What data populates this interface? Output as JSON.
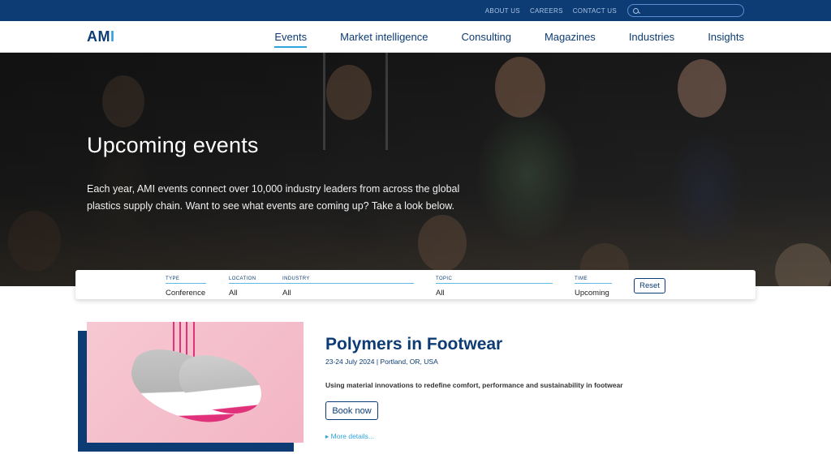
{
  "topbar": {
    "links": [
      "ABOUT US",
      "CAREERS",
      "CONTACT US"
    ],
    "search_placeholder": ""
  },
  "logo": {
    "am": "AM",
    "i": "I"
  },
  "nav": {
    "items": [
      "Events",
      "Market intelligence",
      "Consulting",
      "Magazines",
      "Industries",
      "Insights"
    ],
    "active": "Events"
  },
  "hero": {
    "title": "Upcoming events",
    "text": "Each year, AMI events connect over 10,000 industry leaders from across the global plastics supply chain. Want to see what events are coming up? Take a look below."
  },
  "filters": {
    "type": {
      "label": "TYPE",
      "value": "Conference"
    },
    "location": {
      "label": "LOCATION",
      "value": "All"
    },
    "industry": {
      "label": "INDUSTRY",
      "value": "All"
    },
    "topic": {
      "label": "TOPIC",
      "value": "All"
    },
    "time": {
      "label": "TIME",
      "value": "Upcoming"
    },
    "reset_label": "Reset"
  },
  "event": {
    "title": "Polymers in Footwear",
    "meta": "23-24 July 2024 | Portland, OR, USA",
    "description": "Using material innovations to redefine comfort, performance and sustainability in footwear",
    "book_label": "Book now",
    "more_label": "▸ More details..."
  },
  "colors": {
    "brand_navy": "#0d3c74",
    "accent_blue": "#2ea3dd",
    "image_pink": "#f3b5c4"
  }
}
